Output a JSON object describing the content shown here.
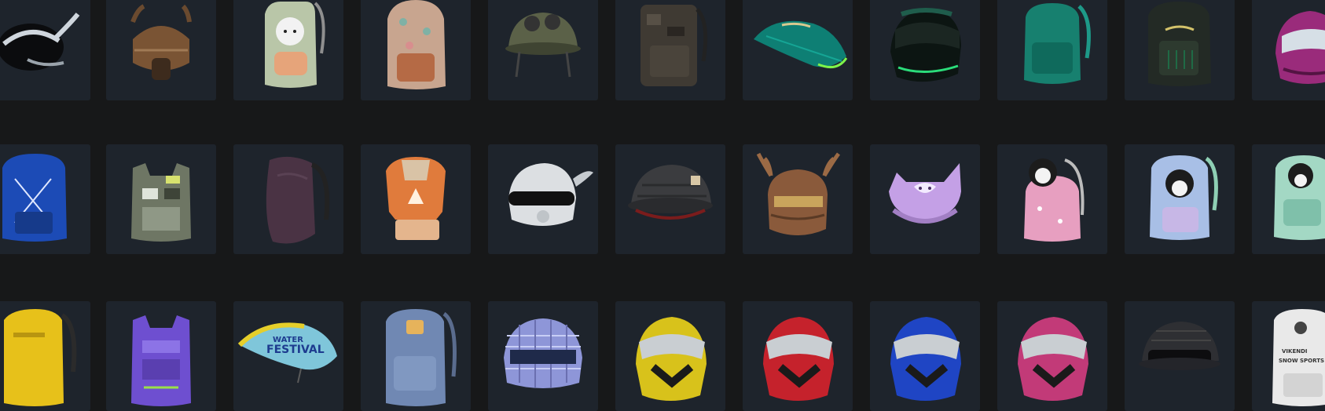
{
  "inventory": {
    "rows": [
      [
        {
          "icon": "chrome-horned-helmet-icon",
          "color": "#cfd6dd"
        },
        {
          "icon": "bronze-viking-helmet-icon",
          "color": "#7a5434"
        },
        {
          "icon": "puppy-backpack-icon",
          "color": "#b9c6a8"
        },
        {
          "icon": "floral-backpack-icon",
          "color": "#c8a58f"
        },
        {
          "icon": "goggles-helmet-icon",
          "color": "#5b6148"
        },
        {
          "icon": "camo-backpack-icon",
          "color": "#3f3a33"
        },
        {
          "icon": "teal-parachute-icon",
          "color": "#0e7f74"
        },
        {
          "icon": "green-racing-helmet-icon",
          "color": "#1f5d4c"
        },
        {
          "icon": "teal-backpack-icon",
          "color": "#17806f"
        },
        {
          "icon": "dark-green-backpack-icon",
          "color": "#2d3a2f"
        },
        {
          "icon": "purple-moto-helmet-icon",
          "color": "#9a2b7b"
        }
      ],
      [
        {
          "icon": "blue-backpack-icon",
          "color": "#1c4bb6"
        },
        {
          "icon": "camo-vest-icon",
          "color": "#6e7664"
        },
        {
          "icon": "dark-purple-backpack-icon",
          "color": "#4a3344"
        },
        {
          "icon": "orange-fox-backpack-icon",
          "color": "#e07b3c"
        },
        {
          "icon": "white-winged-helmet-icon",
          "color": "#dcdfe2"
        },
        {
          "icon": "black-quilted-helmet-icon",
          "color": "#3b3c3f"
        },
        {
          "icon": "antler-helmet-icon",
          "color": "#8a5a3b"
        },
        {
          "icon": "purple-cat-helmet-icon",
          "color": "#c4a0e6"
        },
        {
          "icon": "pink-dog-backpack-icon",
          "color": "#e79fc0"
        },
        {
          "icon": "pastel-dog-backpack-icon",
          "color": "#a8bfe6"
        },
        {
          "icon": "mint-dog-backpack-icon",
          "color": "#a3d8c4"
        }
      ],
      [
        {
          "icon": "yellow-backpack-icon",
          "color": "#e7c11a"
        },
        {
          "icon": "purple-vest-icon",
          "color": "#6e4fd0"
        },
        {
          "icon": "festival-parachute-icon",
          "color": "#7fc6da"
        },
        {
          "icon": "denim-backpack-icon",
          "color": "#7088b3"
        },
        {
          "icon": "disco-helmet-icon",
          "color": "#8e96d8"
        },
        {
          "icon": "yellow-moto-helmet-icon",
          "color": "#d8c21b"
        },
        {
          "icon": "red-moto-helmet-icon",
          "color": "#c5222c"
        },
        {
          "icon": "blue-moto-helmet-icon",
          "color": "#1f45c4"
        },
        {
          "icon": "pink-moto-helmet-icon",
          "color": "#c23a78"
        },
        {
          "icon": "carbon-helmet-icon",
          "color": "#2e2f33"
        },
        {
          "icon": "snow-sports-backpack-icon",
          "color": "#e9e9e9"
        }
      ]
    ],
    "labels": {
      "parachute_top": "WATER",
      "parachute_bottom": "FESTIVAL",
      "backpack_line1": "VIKENDI",
      "backpack_line2": "SNOW SPORTS"
    }
  }
}
